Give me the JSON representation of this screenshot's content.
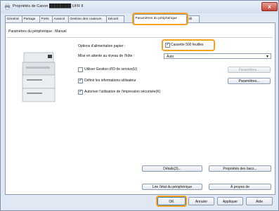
{
  "window": {
    "title": "Propriétés de Canon ████████ UFR II",
    "close_label": "x"
  },
  "tabs": [
    "Général",
    "Partage",
    "Ports",
    "Avancé",
    "Gestion des couleurs",
    "Sécurit",
    "Paramètres du périphérique",
    "rofil"
  ],
  "panel": {
    "heading": "Paramètres du périphérique : Manuel"
  },
  "options": {
    "paper_label": "Options d'alimentation papier :",
    "cassette_label": "Cassette 500 feuilles",
    "spool_label": "Mise en attente au niveau de l'hôte :",
    "spool_value": "Auto",
    "device_mgmt_label": "Utiliser Gestion d'ID de service(U)",
    "device_mgmt_button": "Paramètres...",
    "user_info_label": "Définir les informations utilisateur",
    "user_info_button": "Paramètres...",
    "secure_print_label": "Autoriser l'utilisation de l'impression sécurisée(K)"
  },
  "buttons": {
    "details": "Détails(3)...",
    "tray_props": "Propriétés des bacs...",
    "read_status": "Lire l'état du périphérique",
    "about": "À propos de",
    "ok": "OK",
    "cancel": "Annuler",
    "apply": "Appliquer",
    "help": "Aide"
  }
}
